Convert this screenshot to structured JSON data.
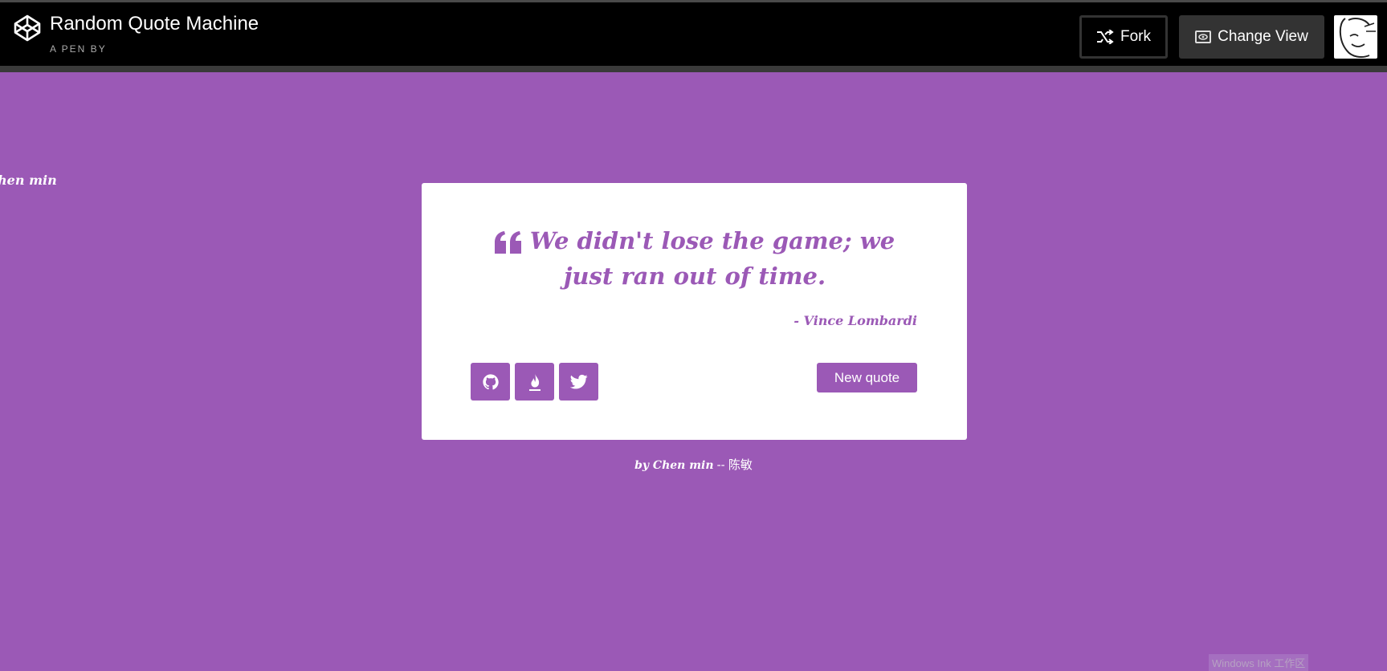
{
  "header": {
    "title": "Random Quote Machine",
    "meta_prefix": "A PEN BY",
    "author": "Chen min",
    "fork_label": "Fork",
    "change_view_label": "Change View",
    "logo_icon": "codepen-logo-icon",
    "fork_icon": "fork-icon",
    "view_icon": "eye-icon"
  },
  "theme": {
    "accent": "#9b59b6",
    "card": "#ffffff",
    "header_bg": "#000000"
  },
  "quote": {
    "text": "We didn't lose the game; we just ran out of time.",
    "author": "- Vince Lombardi",
    "icon": "quote-left-icon"
  },
  "actions": {
    "new_quote": "New quote",
    "social": [
      {
        "icon": "github-icon"
      },
      {
        "icon": "fire-icon"
      },
      {
        "icon": "twitter-icon"
      }
    ]
  },
  "footer": {
    "by": "by Chen min",
    "separator": " -- ",
    "name_cn": "陈敏"
  },
  "watermark": "Windows Ink 工作区"
}
